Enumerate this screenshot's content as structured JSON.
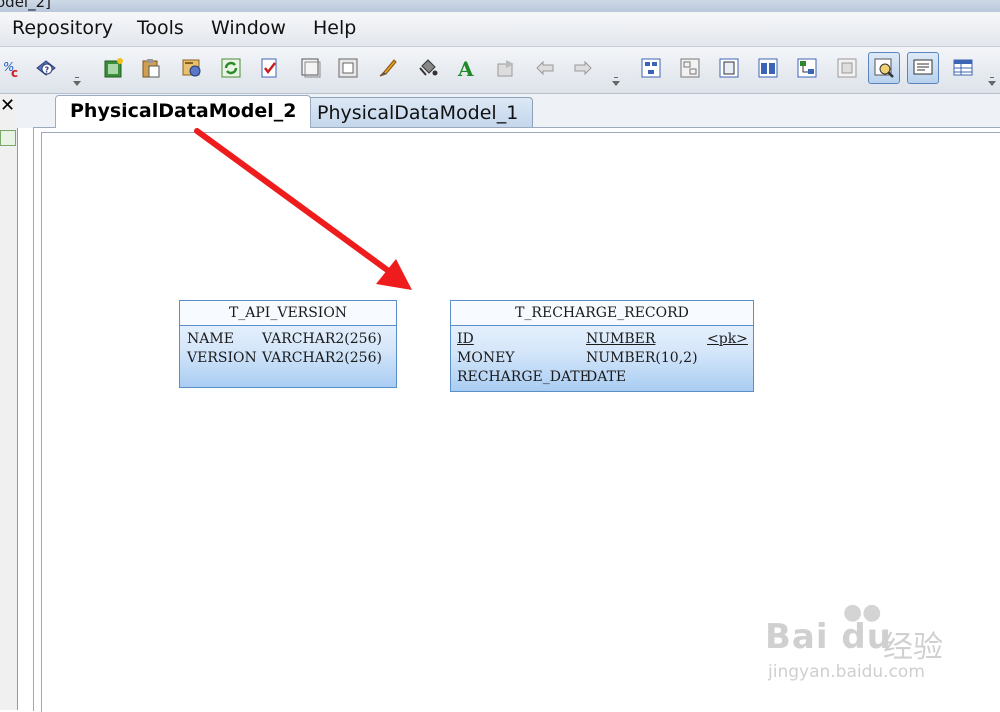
{
  "window": {
    "title_fragment": "odel_2]"
  },
  "menu": [
    "Repository",
    "Tools",
    "Window",
    "Help"
  ],
  "toolbar": {
    "group1": [
      "compare-icon",
      "help-icon"
    ],
    "group2": [
      "new-model-icon",
      "paste-icon",
      "properties-icon",
      "refresh-icon",
      "check-icon",
      "rectangle-icon",
      "frame-icon",
      "brush-icon",
      "fill-icon",
      "font-icon",
      "forward-icon",
      "undo-arrow-icon",
      "redo-arrow-icon"
    ],
    "group3": [
      "diagram-view-icon",
      "entity-view-icon",
      "page-icon",
      "table-view-icon",
      "tree-view-icon",
      "image-view-icon",
      "zoom-icon",
      "comment-icon",
      "grid-icon"
    ]
  },
  "tabs": [
    {
      "label": "PhysicalDataModel_2",
      "active": true
    },
    {
      "label": "PhysicalDataModel_1",
      "active": false
    }
  ],
  "tables": [
    {
      "name": "T_API_VERSION",
      "columns": [
        {
          "name": "NAME",
          "type": "VARCHAR2(256)",
          "key": ""
        },
        {
          "name": "VERSION",
          "type": "VARCHAR2(256)",
          "key": ""
        }
      ]
    },
    {
      "name": "T_RECHARGE_RECORD",
      "columns": [
        {
          "name": "ID",
          "type": "NUMBER",
          "key": "<pk>"
        },
        {
          "name": "MONEY",
          "type": "NUMBER(10,2)",
          "key": ""
        },
        {
          "name": "RECHARGE_DATE",
          "type": "DATE",
          "key": ""
        }
      ]
    }
  ],
  "annotation": {
    "color": "#ee1c1c"
  },
  "watermark": {
    "logo": "Bai du",
    "cn": "经验",
    "url": "jingyan.baidu.com"
  }
}
